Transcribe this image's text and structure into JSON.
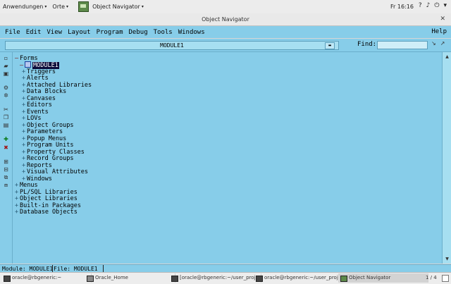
{
  "desktop": {
    "applications_menu": "Anwendungen",
    "places_menu": "Orte",
    "active_app": "Object Navigator",
    "clock": "Fr 16:16"
  },
  "window": {
    "title": "Object Navigator"
  },
  "menubar": {
    "items": [
      "File",
      "Edit",
      "View",
      "Layout",
      "Program",
      "Debug",
      "Tools",
      "Windows"
    ],
    "help": "Help"
  },
  "toolbar": {
    "module_selector": "MODULE1",
    "find_label": "Find:",
    "find_value": ""
  },
  "tree": {
    "root": "Forms",
    "module": "MODULE1",
    "module_children": [
      "Triggers",
      "Alerts",
      "Attached Libraries",
      "Data Blocks",
      "Canvases",
      "Editors",
      "Events",
      "LOVs",
      "Object Groups",
      "Parameters",
      "Popup Menus",
      "Program Units",
      "Property Classes",
      "Record Groups",
      "Reports",
      "Visual Attributes",
      "Windows"
    ],
    "top_level": [
      "Menus",
      "PL/SQL Libraries",
      "Object Libraries",
      "Built-in Packages",
      "Database Objects"
    ]
  },
  "statusbar": {
    "module": "Module: MODULE1",
    "file": "File: MODULE1"
  },
  "taskbar": {
    "tasks": [
      "oracle@rbgeneric:~",
      "Oracle_Home",
      "[oracle@rbgeneric:~/user_proj...",
      "oracle@rbgeneric:~/user_proj...",
      "Object Navigator"
    ],
    "pager": "1 / 4"
  }
}
